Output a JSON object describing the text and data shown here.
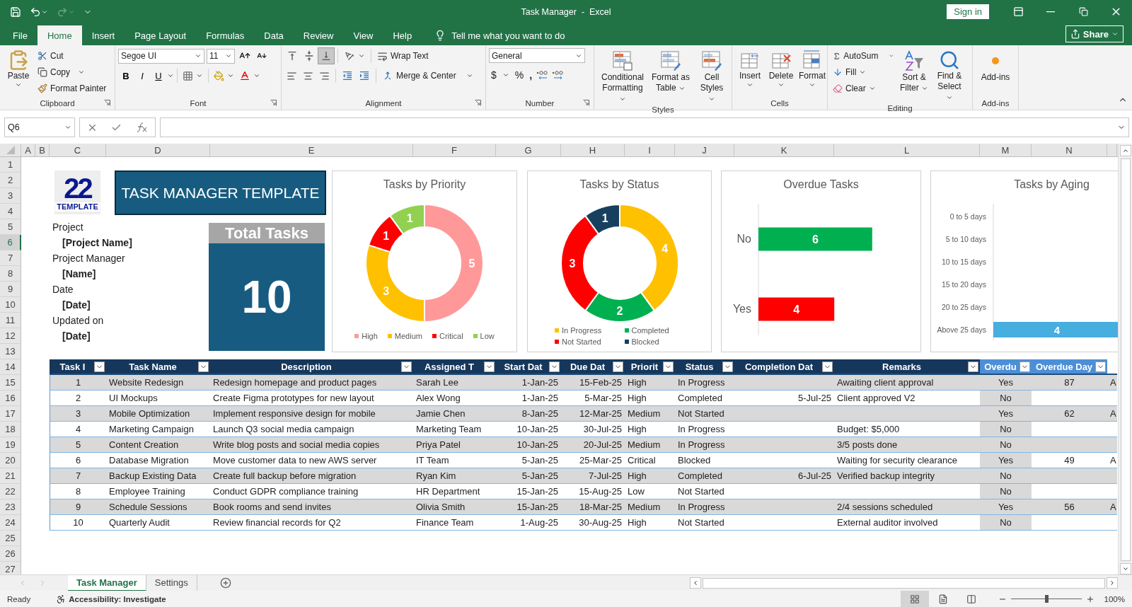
{
  "window": {
    "title": "Task Manager  -  Excel",
    "sign_in": "Sign in"
  },
  "ribbon_tabs": [
    {
      "label": "File",
      "selected": false
    },
    {
      "label": "Home",
      "selected": true
    },
    {
      "label": "Insert",
      "selected": false
    },
    {
      "label": "Page Layout",
      "selected": false
    },
    {
      "label": "Formulas",
      "selected": false
    },
    {
      "label": "Data",
      "selected": false
    },
    {
      "label": "Review",
      "selected": false
    },
    {
      "label": "View",
      "selected": false
    },
    {
      "label": "Help",
      "selected": false
    }
  ],
  "tell_me": "Tell me what you want to do",
  "share": "Share",
  "ribbon_groups": [
    {
      "kind": "clipboard",
      "name": "Clipboard",
      "launcher": true,
      "paste": "Paste",
      "cut": "Cut",
      "copy": "Copy",
      "format_painter": "Format Painter"
    },
    {
      "kind": "font",
      "name": "Font",
      "launcher": true,
      "font": "Segoe UI",
      "size": "11",
      "bold": "B",
      "italic": "I",
      "underline": "U"
    },
    {
      "kind": "alignment",
      "name": "Alignment",
      "launcher": true,
      "vertical": [
        {
          "selected": false
        },
        {
          "selected": false
        },
        {
          "selected": true
        }
      ],
      "wrap": "Wrap Text",
      "merge": "Merge & Center"
    },
    {
      "kind": "number",
      "name": "Number",
      "launcher": true,
      "format": "General",
      "currency": "$",
      "percent": "%",
      "comma": ","
    },
    {
      "kind": "styles",
      "name": "Styles",
      "launcher": false,
      "buttons": [
        "Conditional Formatting",
        "Format as Table",
        "Cell Styles"
      ]
    },
    {
      "kind": "cells",
      "name": "Cells",
      "launcher": false,
      "buttons": [
        "Insert",
        "Delete",
        "Format"
      ]
    },
    {
      "kind": "editing",
      "name": "Editing",
      "launcher": false,
      "autosum": "AutoSum",
      "fill": "Fill",
      "clear": "Clear",
      "sort": "Sort & Filter",
      "find": "Find & Select"
    },
    {
      "kind": "addins",
      "name": "Add-ins",
      "launcher": false,
      "button": "Add-ins"
    }
  ],
  "formula_bar": {
    "name_box": "Q6"
  },
  "column_headers": [
    "A",
    "B",
    "C",
    "D",
    "E",
    "F",
    "G",
    "H",
    "I",
    "J",
    "K",
    "L",
    "M",
    "N"
  ],
  "row_headers": [
    {
      "label": "1",
      "selected": false
    },
    {
      "label": "2",
      "selected": false
    },
    {
      "label": "3",
      "selected": false
    },
    {
      "label": "4",
      "selected": false
    },
    {
      "label": "5",
      "selected": false
    },
    {
      "label": "6",
      "selected": true
    },
    {
      "label": "7",
      "selected": false
    },
    {
      "label": "8",
      "selected": false
    },
    {
      "label": "9",
      "selected": false
    },
    {
      "label": "10",
      "selected": false
    },
    {
      "label": "11",
      "selected": false
    },
    {
      "label": "12",
      "selected": false
    },
    {
      "label": "13",
      "selected": false
    },
    {
      "label": "14",
      "selected": false
    },
    {
      "label": "15",
      "selected": false
    },
    {
      "label": "16",
      "selected": false
    },
    {
      "label": "17",
      "selected": false
    },
    {
      "label": "18",
      "selected": false
    },
    {
      "label": "19",
      "selected": false
    },
    {
      "label": "20",
      "selected": false
    },
    {
      "label": "21",
      "selected": false
    },
    {
      "label": "22",
      "selected": false
    },
    {
      "label": "23",
      "selected": false
    },
    {
      "label": "24",
      "selected": false
    },
    {
      "label": "25",
      "selected": false
    },
    {
      "label": "26",
      "selected": false
    },
    {
      "label": "27",
      "selected": false
    }
  ],
  "logo": {
    "number": "22",
    "word": "TEMPLATE"
  },
  "banner": "TASK MANAGER TEMPLATE",
  "project_info": [
    {
      "label": "Project",
      "value": "[Project Name]"
    },
    {
      "label": "Project Manager",
      "value": "[Name]"
    },
    {
      "label": "Date",
      "value": "[Date]"
    },
    {
      "label": "Updated on",
      "value": "[Date]"
    }
  ],
  "total_tasks": {
    "label": "Total Tasks",
    "value": "10"
  },
  "charts": [
    {
      "chart_data": {
        "type": "donut",
        "title": "Tasks by Priority",
        "categories": [
          "High",
          "Medium",
          "Critical",
          "Low"
        ],
        "values": [
          5,
          3,
          1,
          1
        ],
        "colors": [
          "#ff9999",
          "#ffc000",
          "#ff0000",
          "#92d050"
        ],
        "data_labels": true,
        "legend": "bottom"
      }
    },
    {
      "chart_data": {
        "type": "donut",
        "title": "Tasks by Status",
        "categories": [
          "In Progress",
          "Completed",
          "Not Started",
          "Blocked"
        ],
        "values": [
          4,
          2,
          3,
          1
        ],
        "colors": [
          "#ffc000",
          "#00b050",
          "#ff0000",
          "#17405e"
        ],
        "data_labels": true,
        "legend": "bottom"
      }
    },
    {
      "chart_data": {
        "type": "bar",
        "orientation": "horizontal",
        "title": "Overdue Tasks",
        "categories": [
          "No",
          "Yes"
        ],
        "values": [
          6,
          4
        ],
        "colors": [
          "#00b050",
          "#ff0000"
        ],
        "data_labels": true
      }
    },
    {
      "chart_data": {
        "type": "bar",
        "orientation": "horizontal",
        "title": "Tasks by Aging",
        "categories": [
          "0 to 5 days",
          "5 to 10 days",
          "10 to 15 days",
          "15 to 20 days",
          "20 to 25 days",
          "Above 25 days"
        ],
        "values": [
          0,
          0,
          0,
          0,
          0,
          4
        ],
        "color": "#47aee0",
        "value_labels": [
          null,
          null,
          null,
          null,
          null,
          "4"
        ]
      }
    }
  ],
  "table": {
    "columns": [
      {
        "label": "Task I",
        "kind": "id"
      },
      {
        "label": "Task Name",
        "kind": "text"
      },
      {
        "label": "Description",
        "kind": "text"
      },
      {
        "label": "Assigned T",
        "kind": "text"
      },
      {
        "label": "Start Dat",
        "kind": "date"
      },
      {
        "label": "Due Dat",
        "kind": "date"
      },
      {
        "label": "Priorit",
        "kind": "text"
      },
      {
        "label": "Status",
        "kind": "text"
      },
      {
        "label": "Completion Dat",
        "kind": "date"
      },
      {
        "label": "Remarks",
        "kind": "text"
      },
      {
        "label": "Overdu",
        "kind": "flag",
        "calculated": true,
        "shaded": true
      },
      {
        "label": "Overdue Day",
        "kind": "number",
        "calculated": true
      },
      {
        "kind": "cut"
      }
    ],
    "rows": [
      [
        "1",
        "Website Redesign",
        "Redesign homepage and product pages",
        "Sarah Lee",
        "1-Jan-25",
        "15-Feb-25",
        "High",
        "In Progress",
        null,
        "Awaiting client approval",
        "Yes",
        "87",
        "A"
      ],
      [
        "2",
        "UI Mockups",
        "Create Figma prototypes for new layout",
        "Alex Wong",
        "1-Jan-25",
        "5-Mar-25",
        "High",
        "Completed",
        "5-Jul-25",
        "Client approved V2",
        "No",
        null,
        null
      ],
      [
        "3",
        "Mobile Optimization",
        "Implement responsive design for mobile",
        "Jamie Chen",
        "8-Jan-25",
        "12-Mar-25",
        "Medium",
        "Not Started",
        null,
        null,
        "Yes",
        "62",
        "A"
      ],
      [
        "4",
        "Marketing Campaign",
        "Launch Q3 social media campaign",
        "Marketing Team",
        "10-Jan-25",
        "30-Jul-25",
        "High",
        "In Progress",
        null,
        "Budget: $5,000",
        "No",
        null,
        null
      ],
      [
        "5",
        "Content Creation",
        "Write blog posts and social media copies",
        "Priya Patel",
        "10-Jan-25",
        "20-Jul-25",
        "Medium",
        "In Progress",
        null,
        "3/5 posts done",
        "No",
        null,
        null
      ],
      [
        "6",
        "Database Migration",
        "Move customer data to new AWS server",
        "IT Team",
        "5-Jan-25",
        "25-Mar-25",
        "Critical",
        "Blocked",
        null,
        "Waiting for security clearance",
        "Yes",
        "49",
        "A"
      ],
      [
        "7",
        "Backup Existing Data",
        "Create full backup before migration",
        "Ryan Kim",
        "5-Jan-25",
        "7-Jul-25",
        "High",
        "Completed",
        "6-Jul-25",
        "Verified backup integrity",
        "No",
        null,
        null
      ],
      [
        "8",
        "Employee Training",
        "Conduct GDPR compliance training",
        "HR Department",
        "15-Jan-25",
        "15-Aug-25",
        "Low",
        "Not Started",
        null,
        null,
        "No",
        null,
        null
      ],
      [
        "9",
        "Schedule Sessions",
        "Book rooms and send invites",
        "Olivia Smith",
        "15-Jan-25",
        "18-Mar-25",
        "Medium",
        "In Progress",
        null,
        "2/4 sessions scheduled",
        "Yes",
        "56",
        "A"
      ],
      [
        "10",
        "Quarterly Audit",
        "Review financial records for Q2",
        "Finance Team",
        "1-Aug-25",
        "30-Aug-25",
        "High",
        "Not Started",
        null,
        "External auditor involved",
        "No",
        null,
        null
      ]
    ]
  },
  "sheet_tabs": [
    {
      "label": "Task Manager",
      "selected": true
    },
    {
      "label": "Settings",
      "selected": false
    }
  ],
  "status_bar": {
    "ready": "Ready",
    "accessibility": "Accessibility: Investigate",
    "views": [
      {
        "selected": true
      },
      {
        "selected": false
      },
      {
        "selected": false
      }
    ],
    "zoom": {
      "level": 0.5
    },
    "zoom_text": "100%"
  }
}
